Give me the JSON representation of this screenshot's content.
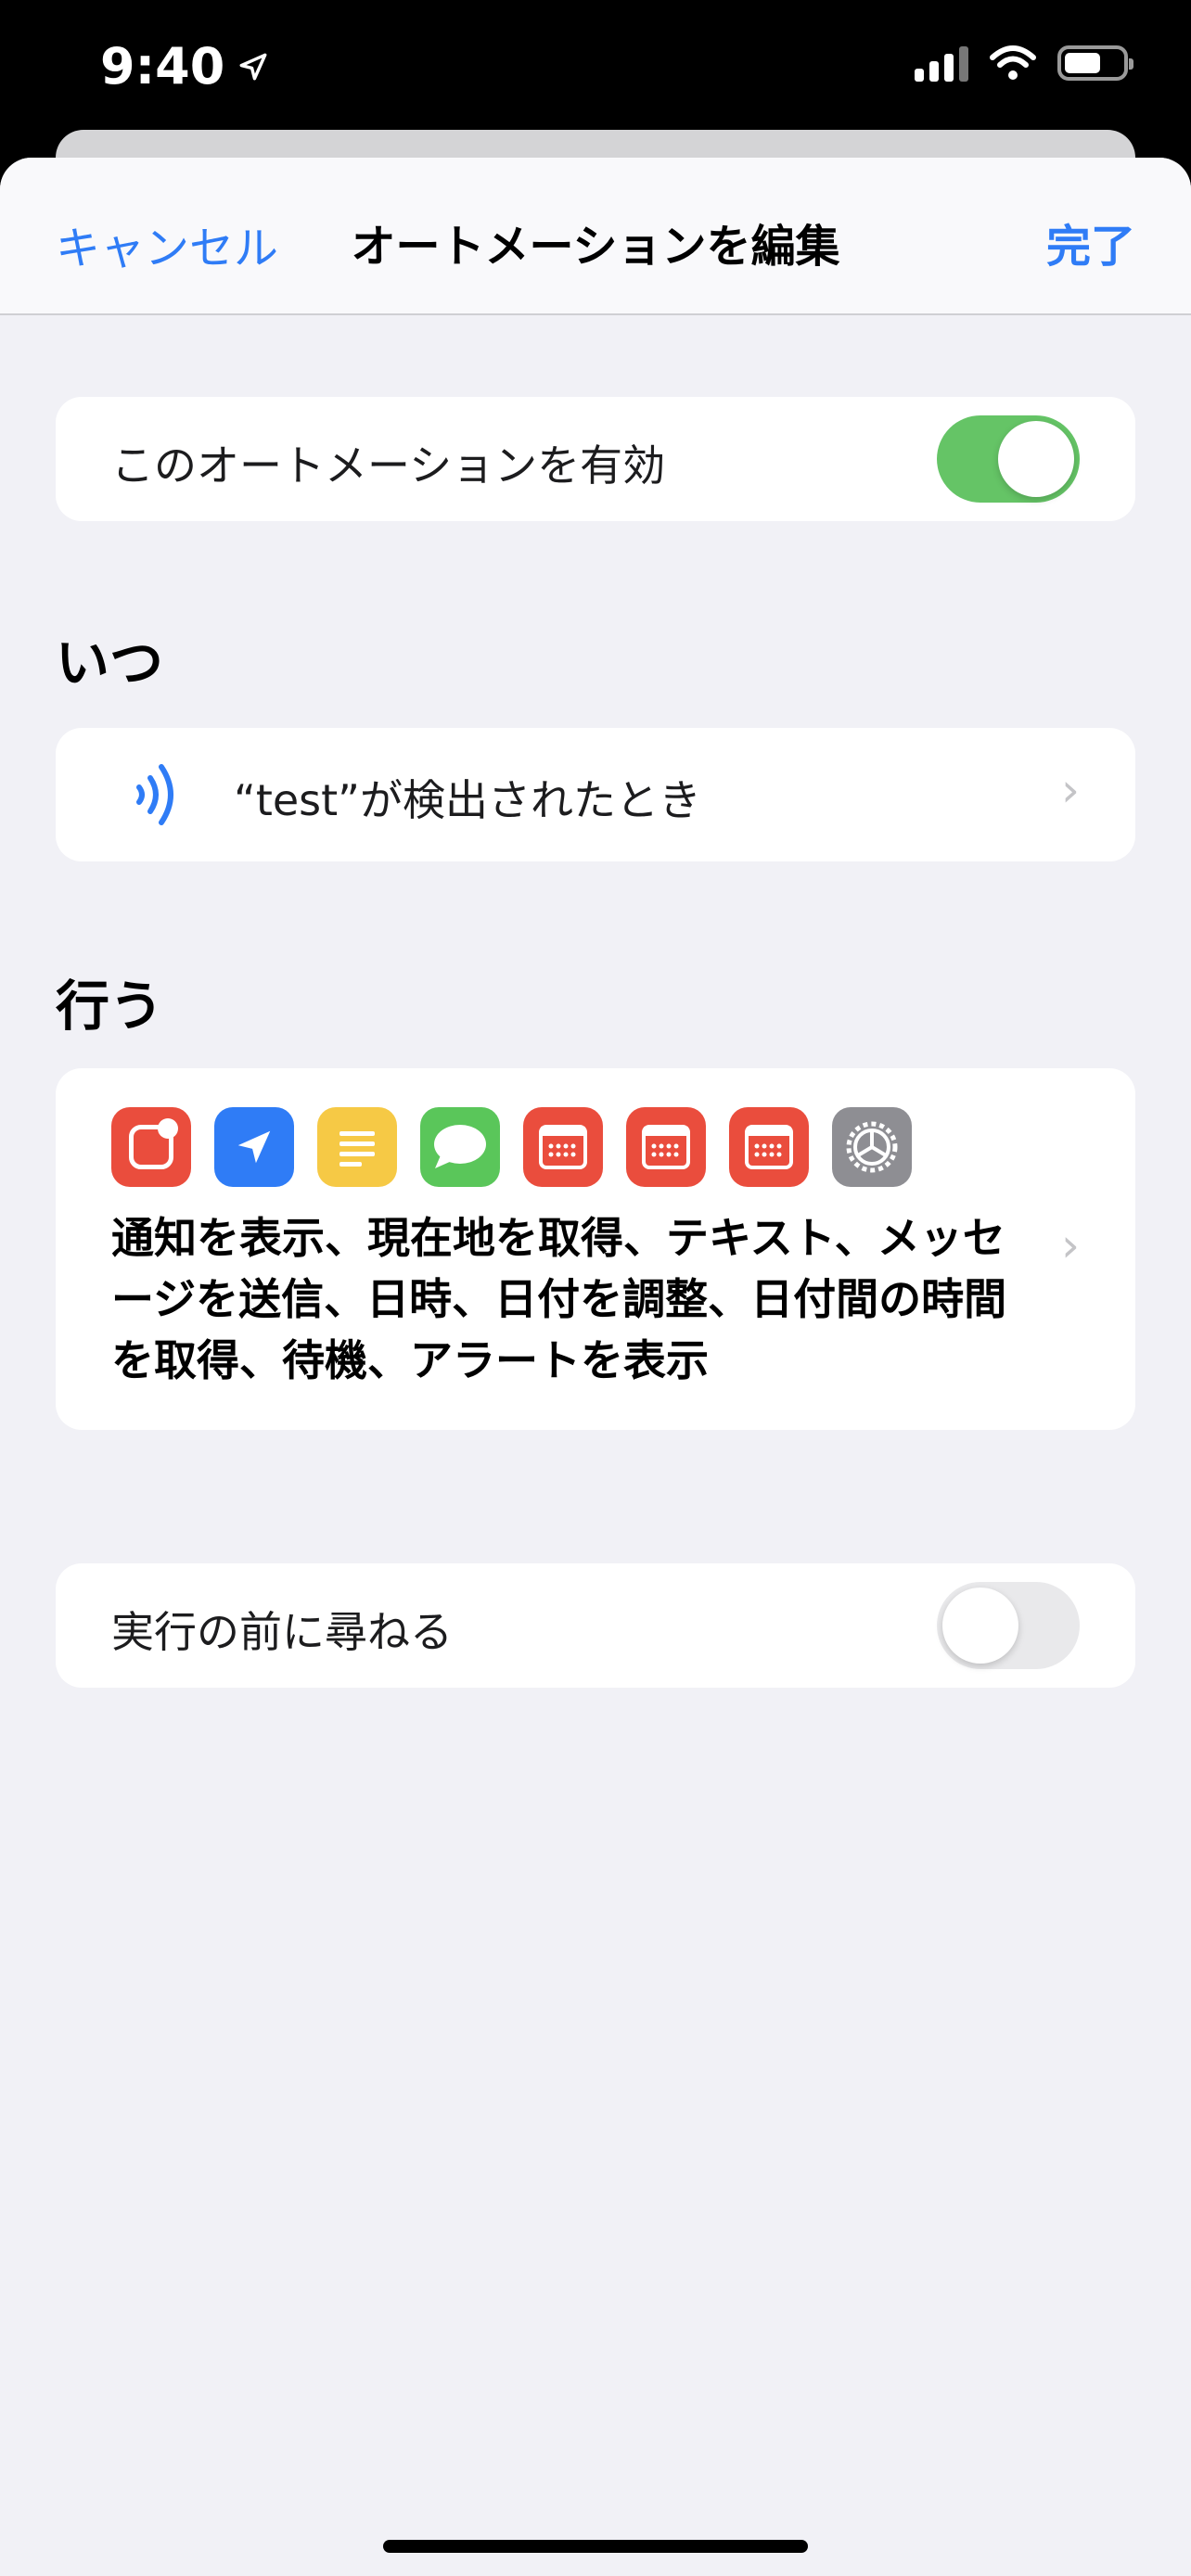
{
  "status_bar": {
    "time": "9:40"
  },
  "nav": {
    "cancel": "キャンセル",
    "title": "オートメーションを編集",
    "done": "完了"
  },
  "enable": {
    "label": "このオートメーションを有効",
    "on": true
  },
  "when": {
    "header": "いつ",
    "trigger": "“test”が検出されたとき",
    "icon": "nfc-icon"
  },
  "do": {
    "header": "行う",
    "icons": [
      {
        "name": "show-notification-icon",
        "color": "#ea4d3d"
      },
      {
        "name": "location-icon",
        "color": "#2f7cf6"
      },
      {
        "name": "text-icon",
        "color": "#f6c945"
      },
      {
        "name": "messages-icon",
        "color": "#5ac65a"
      },
      {
        "name": "date-icon",
        "color": "#ea4d3d"
      },
      {
        "name": "adjust-date-icon",
        "color": "#ea4d3d"
      },
      {
        "name": "time-between-dates-icon",
        "color": "#ea4d3d"
      },
      {
        "name": "settings-icon",
        "color": "#8e8e93"
      }
    ],
    "summary": "通知を表示、現在地を取得、テキスト、メッセージを送信、日時、日付を調整、日付間の時間を取得、待機、アラートを表示"
  },
  "ask": {
    "label": "実行の前に尋ねる",
    "on": false
  }
}
